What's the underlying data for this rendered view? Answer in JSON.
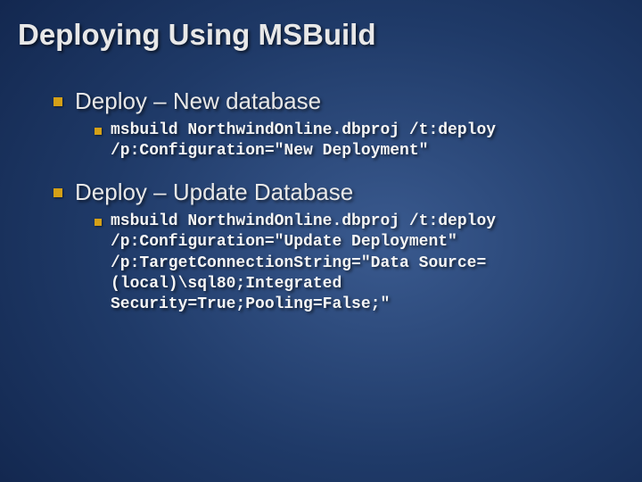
{
  "title": "Deploying Using MSBuild",
  "sections": [
    {
      "heading": "Deploy – New database",
      "code": "msbuild NorthwindOnline.dbproj /t:deploy /p:Configuration=\"New Deployment\""
    },
    {
      "heading": "Deploy – Update Database",
      "code": "msbuild NorthwindOnline.dbproj /t:deploy /p:Configuration=\"Update Deployment\" /p:TargetConnectionString=\"Data Source=(local)\\sql80;Integrated Security=True;Pooling=False;\""
    }
  ]
}
